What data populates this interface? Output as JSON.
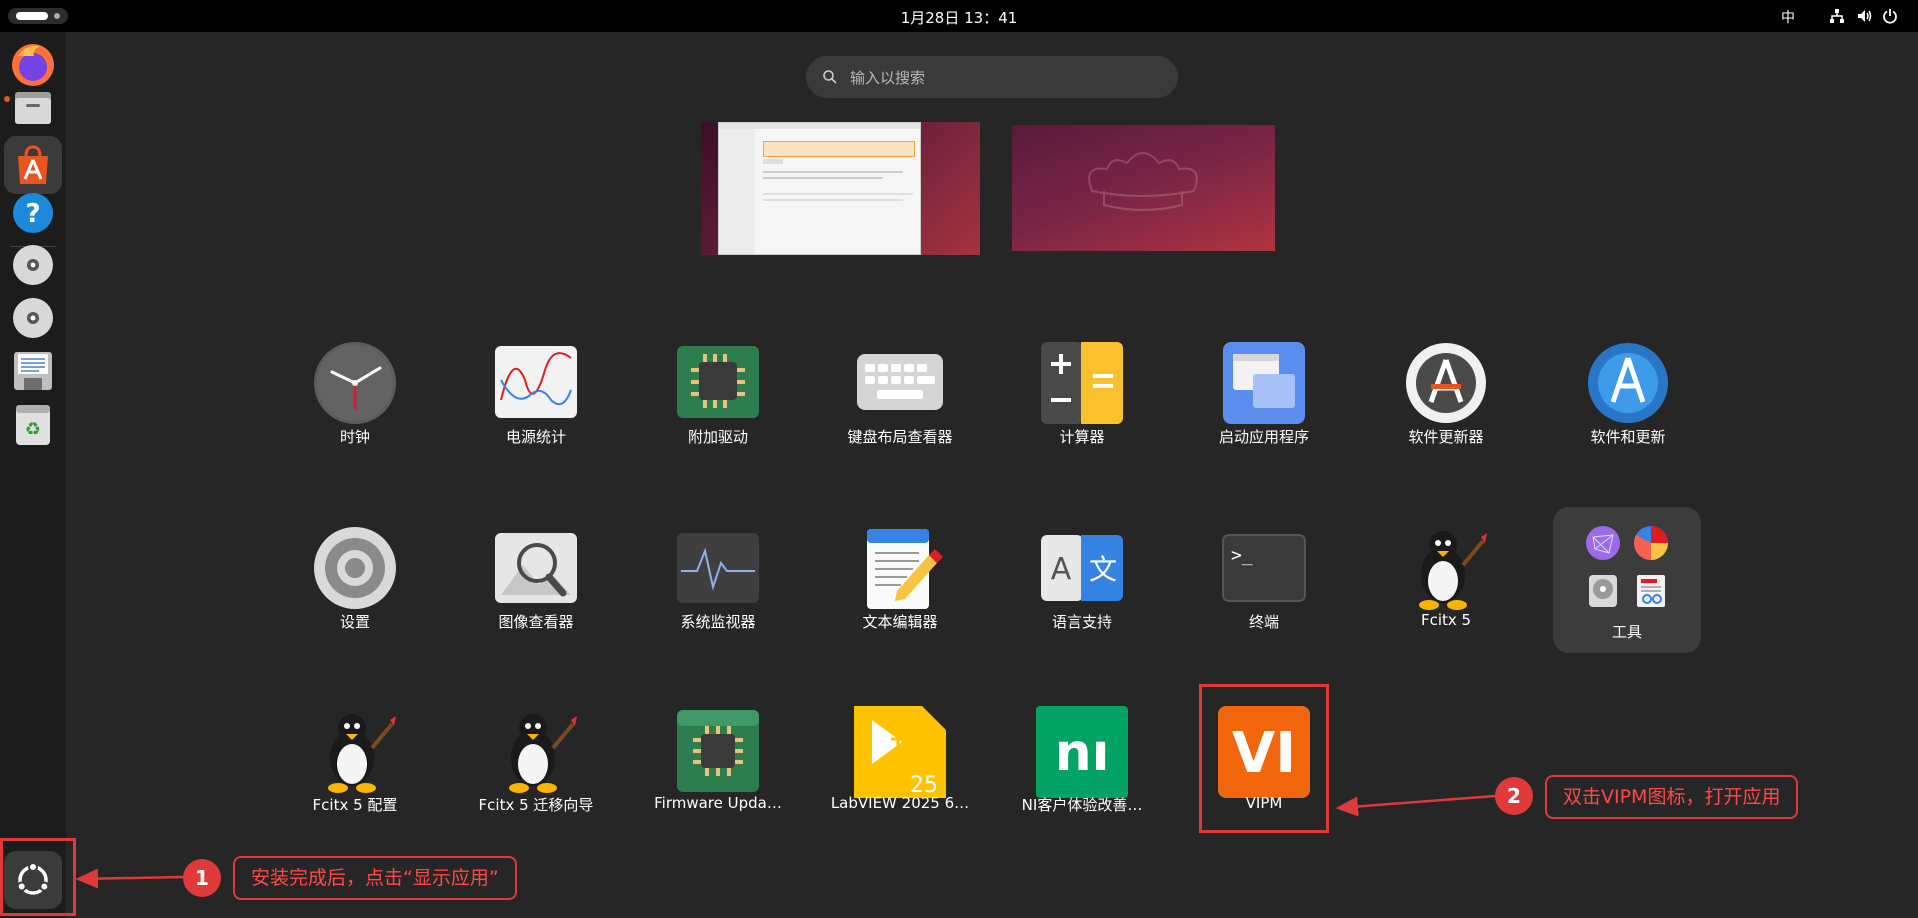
{
  "topbar": {
    "clock": "1月28日  13：41",
    "input_method": "中",
    "tray_icons": [
      "network-icon",
      "volume-icon",
      "power-icon"
    ]
  },
  "dock": {
    "items": [
      {
        "name": "firefox",
        "running": false
      },
      {
        "name": "files",
        "running": true
      },
      {
        "name": "app-center",
        "running": true,
        "active": true
      },
      {
        "name": "help",
        "running": false
      },
      {
        "name": "disc-1",
        "running": false
      },
      {
        "name": "disc-2",
        "running": false
      },
      {
        "name": "floppy-document",
        "running": false
      },
      {
        "name": "trash",
        "running": false
      }
    ],
    "show_apps": "show-apps"
  },
  "search": {
    "placeholder": "输入以搜索"
  },
  "apps": [
    {
      "label": "时钟",
      "icon": "clock-icon"
    },
    {
      "label": "电源统计",
      "icon": "power-statistics-icon"
    },
    {
      "label": "附加驱动",
      "icon": "chip-icon"
    },
    {
      "label": "键盘布局查看器",
      "icon": "keyboard-icon"
    },
    {
      "label": "计算器",
      "icon": "calculator-icon"
    },
    {
      "label": "启动应用程序",
      "icon": "startup-apps-icon"
    },
    {
      "label": "软件更新器",
      "icon": "software-updater-icon"
    },
    {
      "label": "软件和更新",
      "icon": "software-sources-icon"
    },
    {
      "label": "设置",
      "icon": "settings-icon"
    },
    {
      "label": "图像查看器",
      "icon": "image-viewer-icon"
    },
    {
      "label": "系统监视器",
      "icon": "system-monitor-icon"
    },
    {
      "label": "文本编辑器",
      "icon": "text-editor-icon"
    },
    {
      "label": "语言支持",
      "icon": "language-icon"
    },
    {
      "label": "终端",
      "icon": "terminal-icon"
    },
    {
      "label": "Fcitx 5",
      "icon": "tux-icon"
    },
    {
      "label": "工具",
      "icon": "folder-icon"
    },
    {
      "label": "Fcitx 5 配置",
      "icon": "tux-icon"
    },
    {
      "label": "Fcitx 5 迁移向导",
      "icon": "tux-icon"
    },
    {
      "label": "Firmware Upda…",
      "icon": "firmware-icon"
    },
    {
      "label": "LabVIEW 2025 6…",
      "icon": "labview-icon"
    },
    {
      "label": "NI客户体验改善…",
      "icon": "ni-icon"
    },
    {
      "label": "VIPM",
      "icon": "vipm-icon"
    }
  ],
  "app_icon_text": {
    "terminal": ">_",
    "labview_version": "25",
    "ni": "nı",
    "vipm": "VI",
    "lang_a": "A",
    "lang_zh": "文"
  },
  "callouts": [
    {
      "num": "1",
      "text": "安装完成后，点击“显示应用”"
    },
    {
      "num": "2",
      "text": "双击VIPM图标，打开应用"
    }
  ],
  "colors": {
    "accent_red": "#e0393a",
    "ubuntu_orange": "#e95420",
    "vipm_orange": "#f2660d",
    "ni_green": "#03a463",
    "labview_yellow": "#fdc300"
  }
}
